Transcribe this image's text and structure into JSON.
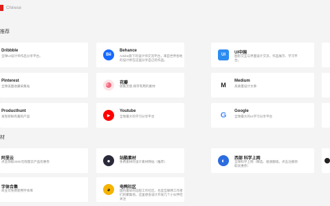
{
  "header": {
    "language_label": "Chinese",
    "flag_color": "#e0201c"
  },
  "sections": [
    {
      "title": "推荐"
    },
    {
      "title": "材"
    }
  ],
  "cards": [
    {
      "name": "Dribbble",
      "desc": "全球UI设计师作品分享平台。",
      "icon": "dribbble-logo-icon",
      "icon_color": "#ea4c89"
    },
    {
      "name": "Behance",
      "desc": "Adobe旗下的设计师交流平台，来自世界各地的设计师在这里分享自己的作品。",
      "icon": "behance-logo-icon",
      "icon_color": "#1769ff",
      "icon_text": "Bē"
    },
    {
      "name": "UI中国",
      "desc": "图形交互与界面设计交流、作品展示、学习平台。",
      "icon": "uichina-logo-icon",
      "icon_color": "#2d8cf0",
      "icon_text": "UI"
    },
    {
      "name": "Pinterest",
      "desc": "全球美图收藏采集站",
      "icon": "pinterest-logo-icon",
      "icon_color": "#e60023"
    },
    {
      "name": "花瓣",
      "desc": "收集灵感,保存有用的素材",
      "icon": "huaban-logo-icon",
      "icon_color": "#f06a7c"
    },
    {
      "name": "Medium",
      "desc": "高质量设计文章",
      "icon": "medium-logo-icon",
      "icon_color": "#1f1f1f",
      "icon_text": "M"
    },
    {
      "name": "Producthunt",
      "desc": "发现新鲜有趣的产品",
      "icon": "producthunt-logo-icon",
      "icon_color": "#da552f"
    },
    {
      "name": "Youtube",
      "desc": "全球最大的学习分享平台",
      "icon": "youtube-logo-icon",
      "icon_color": "#ff0000",
      "icon_text": "▶"
    },
    {
      "name": "Google",
      "desc": "全球最大的UI学习分享平台",
      "icon": "google-logo-icon",
      "icon_color": "#4285f4",
      "icon_text": "G"
    },
    {
      "name": "阿里云",
      "desc": "点击领取2000元限量云产品优惠卷",
      "icon": "aliyun-logo-icon",
      "icon_color": "#ff6a00"
    },
    {
      "name": "站酷素材",
      "desc": "免费素材的设计素材网站（推荐）",
      "icon": "zcool-sucai-logo-icon",
      "icon_color": "#2a2a3a",
      "icon_text": "●"
    },
    {
      "name": "西部 科学上网",
      "desc": "全球科学上网（精选、极速翻墙，点击注册领取优惠券）",
      "icon": "xibu-vpn-logo-icon",
      "icon_color": "#2d6cdf",
      "icon_text": "◐"
    },
    {
      "name": "字体合集",
      "desc": "商业可免费使用字体库",
      "icon": "font-collection-icon",
      "icon_color": "#444"
    },
    {
      "name": "电鸭社区",
      "desc": "国内最早的远程工作社区，也是互联网工作者们的聚集地。这里想会设计开发几个小伙伴吃关注",
      "icon": "eleduck-logo-icon",
      "icon_color": "#f5b400",
      "icon_text": "◕"
    }
  ]
}
